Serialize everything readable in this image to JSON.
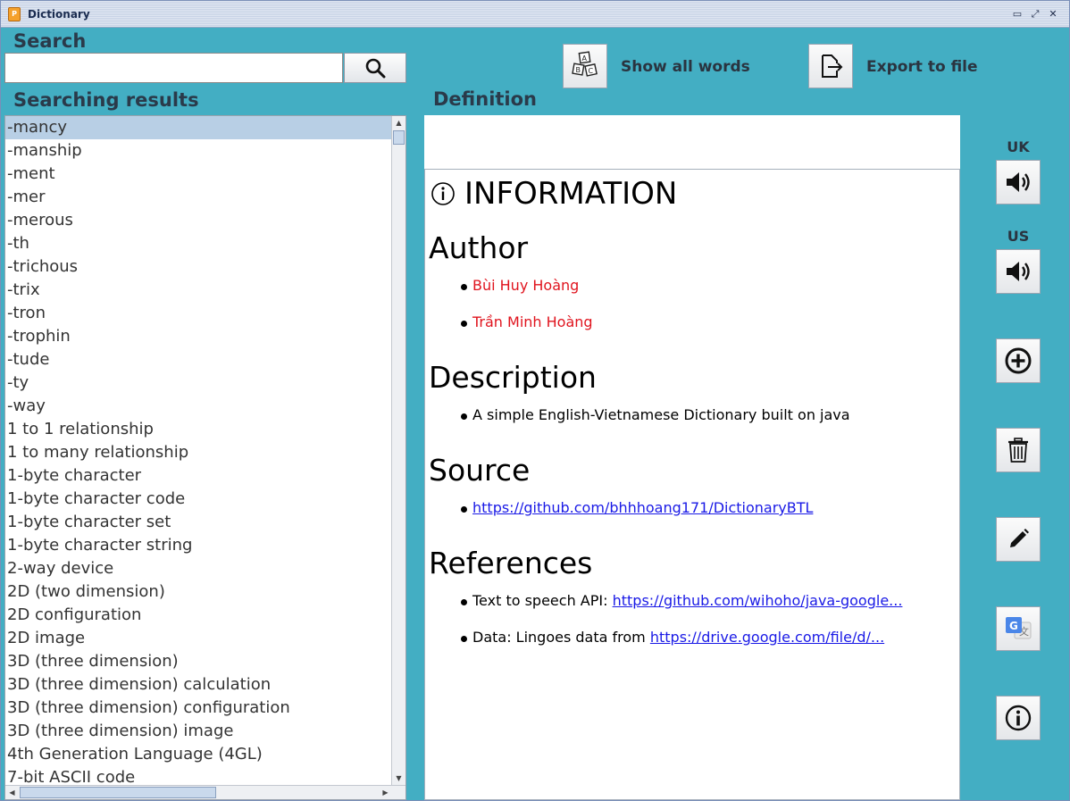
{
  "window": {
    "title": "Dictionary",
    "app_icon": "dictionary-app-icon"
  },
  "search": {
    "label": "Search",
    "value": "",
    "placeholder": ""
  },
  "toolbar": {
    "show_all_label": "Show all words",
    "export_label": "Export to file"
  },
  "results": {
    "label": "Searching results",
    "selected_index": 0,
    "items": [
      "-mancy",
      "-manship",
      "-ment",
      "-mer",
      "-merous",
      "-th",
      "-trichous",
      "-trix",
      "-tron",
      "-trophin",
      "-tude",
      "-ty",
      "-way",
      "1 to 1 relationship",
      "1 to many relationship",
      "1-byte character",
      "1-byte character code",
      "1-byte character set",
      "1-byte character string",
      "2-way device",
      "2D (two dimension)",
      "2D configuration",
      "2D image",
      "3D (three dimension)",
      "3D (three dimension) calculation",
      "3D (three dimension) configuration",
      "3D (three dimension) image",
      "4th Generation Language (4GL)",
      "7-bit ASCII code"
    ]
  },
  "definition": {
    "label": "Definition",
    "heading": "INFORMATION",
    "author_title": "Author",
    "authors": [
      "Bùi Huy Hoàng",
      "Trần Minh Hoàng"
    ],
    "description_title": "Description",
    "description": "A simple English-Vietnamese Dictionary built on java",
    "source_title": "Source",
    "source_link": "https://github.com/bhhhoang171/DictionaryBTL",
    "references_title": "References",
    "ref1_prefix": "Text to speech API: ",
    "ref1_link": "https://github.com/wihoho/java-google...",
    "ref2_prefix": "Data: Lingoes data from ",
    "ref2_link": "https://drive.google.com/file/d/..."
  },
  "side": {
    "uk_label": "UK",
    "us_label": "US"
  },
  "colors": {
    "background": "#43aec3",
    "selected_row": "#b8cfe5",
    "author_red": "#e0141e",
    "link_blue": "#1a1ae6"
  }
}
